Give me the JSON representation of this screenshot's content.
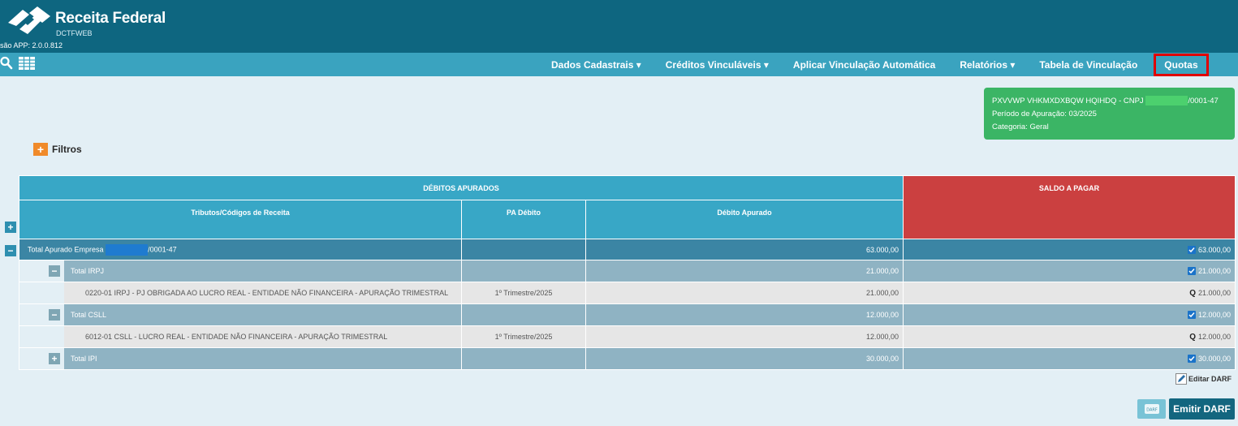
{
  "header": {
    "title": "Receita Federal",
    "subtitle": "DCTFWEB",
    "version": "são APP: 2.0.0.812"
  },
  "nav": {
    "items": [
      {
        "label": "Dados Cadastrais",
        "dropdown": true
      },
      {
        "label": "Créditos Vinculáveis",
        "dropdown": true
      },
      {
        "label": "Aplicar Vinculação Automática",
        "dropdown": false
      },
      {
        "label": "Relatórios",
        "dropdown": true
      },
      {
        "label": "Tabela de Vinculação",
        "dropdown": false
      },
      {
        "label": "Quotas",
        "dropdown": false,
        "highlighted": true
      }
    ]
  },
  "info": {
    "company_prefix": "PXVVWP VHKMXDXBQW HQIHDQ - CNPJ",
    "cnpj_suffix": "/0001-47",
    "period": "Período de Apuração: 03/2025",
    "category": "Categoria: Geral"
  },
  "filters": {
    "label": "Filtros"
  },
  "table": {
    "header_debitos": "DÉBITOS APURADOS",
    "header_saldo": "SALDO A PAGAR",
    "col_tributos": "Tributos/Códigos de Receita",
    "col_pa": "PA Débito",
    "col_debito": "Débito Apurado",
    "total": {
      "label_prefix": "Total Apurado Empresa",
      "label_suffix": "/0001-47",
      "debito": "63.000,00",
      "saldo": "63.000,00"
    },
    "groups": [
      {
        "label": "Total IRPJ",
        "debito": "21.000,00",
        "saldo": "21.000,00"
      },
      {
        "label": "0220-01 IRPJ - PJ OBRIGADA AO LUCRO REAL - ENTIDADE NÃO FINANCEIRA - APURAÇÃO TRIMESTRAL",
        "pa": "1º Trimestre/2025",
        "debito": "21.000,00",
        "saldo": "21.000,00"
      },
      {
        "label": "Total CSLL",
        "debito": "12.000,00",
        "saldo": "12.000,00"
      },
      {
        "label": "6012-01 CSLL - LUCRO REAL - ENTIDADE NÃO FINANCEIRA - APURAÇÃO TRIMESTRAL",
        "pa": "1º Trimestre/2025",
        "debito": "12.000,00",
        "saldo": "12.000,00"
      },
      {
        "label": "Total IPI",
        "debito": "30.000,00",
        "saldo": "30.000,00"
      }
    ]
  },
  "actions": {
    "edit_darf": "Editar DARF",
    "darf_icon": "DARF",
    "emitir": "Emitir DARF"
  },
  "colors": {
    "header": "#0e6680",
    "navbar": "#3aa3bf",
    "info_card": "#3bb565",
    "saldo_header": "#cb4040",
    "highlight": "#e00000"
  }
}
